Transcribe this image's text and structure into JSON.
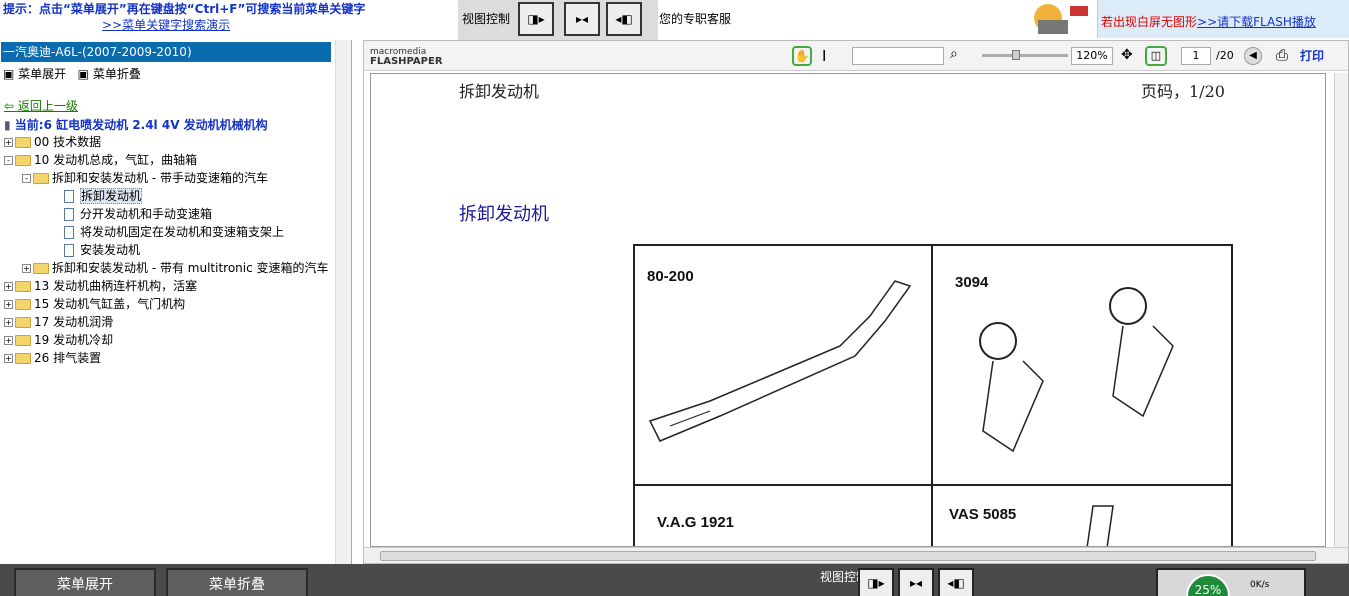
{
  "topbar": {
    "tip": "提示：点击“菜单展开”再在键盘按“Ctrl+F”可搜索当前菜单关键字",
    "tip_link": ">>菜单关键字搜索演示",
    "view_control": "视图控制",
    "service": "您的专职客服",
    "flash_warn": "若出现白屏无图形",
    "flash_link": ">>请下载FLASH播放"
  },
  "left": {
    "car_title": "一汽奥迪-A6L-(2007-2009-2010)",
    "expand_menu": "菜单展开",
    "collapse_menu": "菜单折叠",
    "back": "返回上一级",
    "current": "当前:6 缸电喷发动机  2.4l 4V 发动机机械机构",
    "tree": [
      {
        "label": "00 技术数据",
        "level": 0,
        "type": "folder",
        "toggle": "+"
      },
      {
        "label": "10 发动机总成，气缸，曲轴箱",
        "level": 0,
        "type": "folder",
        "toggle": "-"
      },
      {
        "label": "拆卸和安装发动机  - 带手动变速箱的汽车",
        "level": 1,
        "type": "folder",
        "toggle": "-"
      },
      {
        "label": "拆卸发动机",
        "level": 2,
        "type": "doc",
        "selected": true
      },
      {
        "label": "分开发动机和手动变速箱",
        "level": 2,
        "type": "doc"
      },
      {
        "label": "将发动机固定在发动机和变速箱支架上",
        "level": 2,
        "type": "doc"
      },
      {
        "label": "安装发动机",
        "level": 2,
        "type": "doc"
      },
      {
        "label": "拆卸和安装发动机  - 带有  multitronic 变速箱的汽车",
        "level": 1,
        "type": "folder",
        "toggle": "+"
      },
      {
        "label": "13 发动机曲柄连杆机构，活塞",
        "level": 0,
        "type": "folder",
        "toggle": "+"
      },
      {
        "label": "15 发动机气缸盖，气门机构",
        "level": 0,
        "type": "folder",
        "toggle": "+"
      },
      {
        "label": "17 发动机润滑",
        "level": 0,
        "type": "folder",
        "toggle": "+"
      },
      {
        "label": "19 发动机冷却",
        "level": 0,
        "type": "folder",
        "toggle": "+"
      },
      {
        "label": "26 排气装置",
        "level": 0,
        "type": "folder",
        "toggle": "+"
      }
    ]
  },
  "viewer": {
    "logo_top": "macromedia",
    "logo_bottom": "FLASHPAPER",
    "zoom": "120%",
    "page_current": "1",
    "page_total": "/20",
    "print": "打印",
    "page_header_left": "拆卸发动机",
    "page_header_right": "页码，1/20",
    "page_title": "拆卸发动机",
    "tools": [
      "80-200",
      "3094",
      "V.A.G 1921",
      "VAS 5085"
    ]
  },
  "bottom": {
    "expand": "菜单展开",
    "collapse": "菜单折叠",
    "view_control": "视图控制",
    "speed_pct": "25%",
    "speed_rate": "0K/s"
  }
}
